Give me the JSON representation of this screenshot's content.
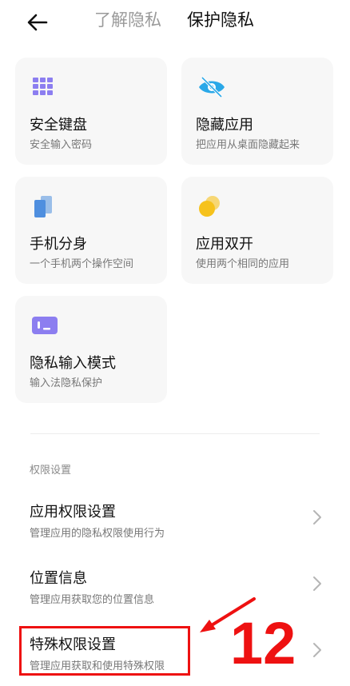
{
  "header": {
    "tabs": [
      {
        "label": "了解隐私",
        "active": false
      },
      {
        "label": "保护隐私",
        "active": true
      }
    ]
  },
  "cards": [
    {
      "title": "安全键盘",
      "subtitle": "安全输入密码",
      "icon": "keyboard-grid-icon"
    },
    {
      "title": "隐藏应用",
      "subtitle": "把应用从桌面隐藏起来",
      "icon": "eye-hidden-icon"
    },
    {
      "title": "手机分身",
      "subtitle": "一个手机两个操作空间",
      "icon": "dual-phone-icon"
    },
    {
      "title": "应用双开",
      "subtitle": "使用两个相同的应用",
      "icon": "dual-circle-icon"
    },
    {
      "title": "隐私输入模式",
      "subtitle": "输入法隐私保护",
      "icon": "private-input-icon"
    }
  ],
  "permissions": {
    "section_label": "权限设置",
    "rows": [
      {
        "title": "应用权限设置",
        "subtitle": "管理应用的隐私权限使用行为"
      },
      {
        "title": "位置信息",
        "subtitle": "管理应用获取您的位置信息"
      },
      {
        "title": "特殊权限设置",
        "subtitle": "管理应用获取和使用特殊权限"
      }
    ]
  },
  "annotation": {
    "number": "12",
    "color": "#ee1111"
  },
  "colors": {
    "card_bg": "#f7f7f7",
    "keyboard_icon": "#8c7ef0",
    "eye_icon": "#2aa8e8",
    "dual_phone_icon": "#4f8fdf",
    "dual_circle_icon": "#f6c21c",
    "private_input_icon": "#8c7ef0"
  }
}
